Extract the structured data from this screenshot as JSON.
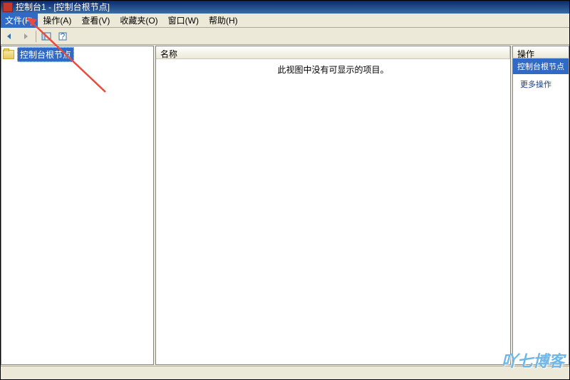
{
  "titlebar": {
    "text": "控制台1 - [控制台根节点]"
  },
  "menu": {
    "file": "文件(F)",
    "action": "操作(A)",
    "view": "查看(V)",
    "favorites": "收藏夹(O)",
    "window": "窗口(W)",
    "help": "帮助(H)"
  },
  "tree": {
    "root": "控制台根节点"
  },
  "list": {
    "header_name": "名称",
    "empty_text": "此视图中没有可显示的项目。"
  },
  "actions": {
    "title": "操作",
    "selected": "控制台根节点",
    "more": "更多操作"
  },
  "watermark": "吖七博客"
}
